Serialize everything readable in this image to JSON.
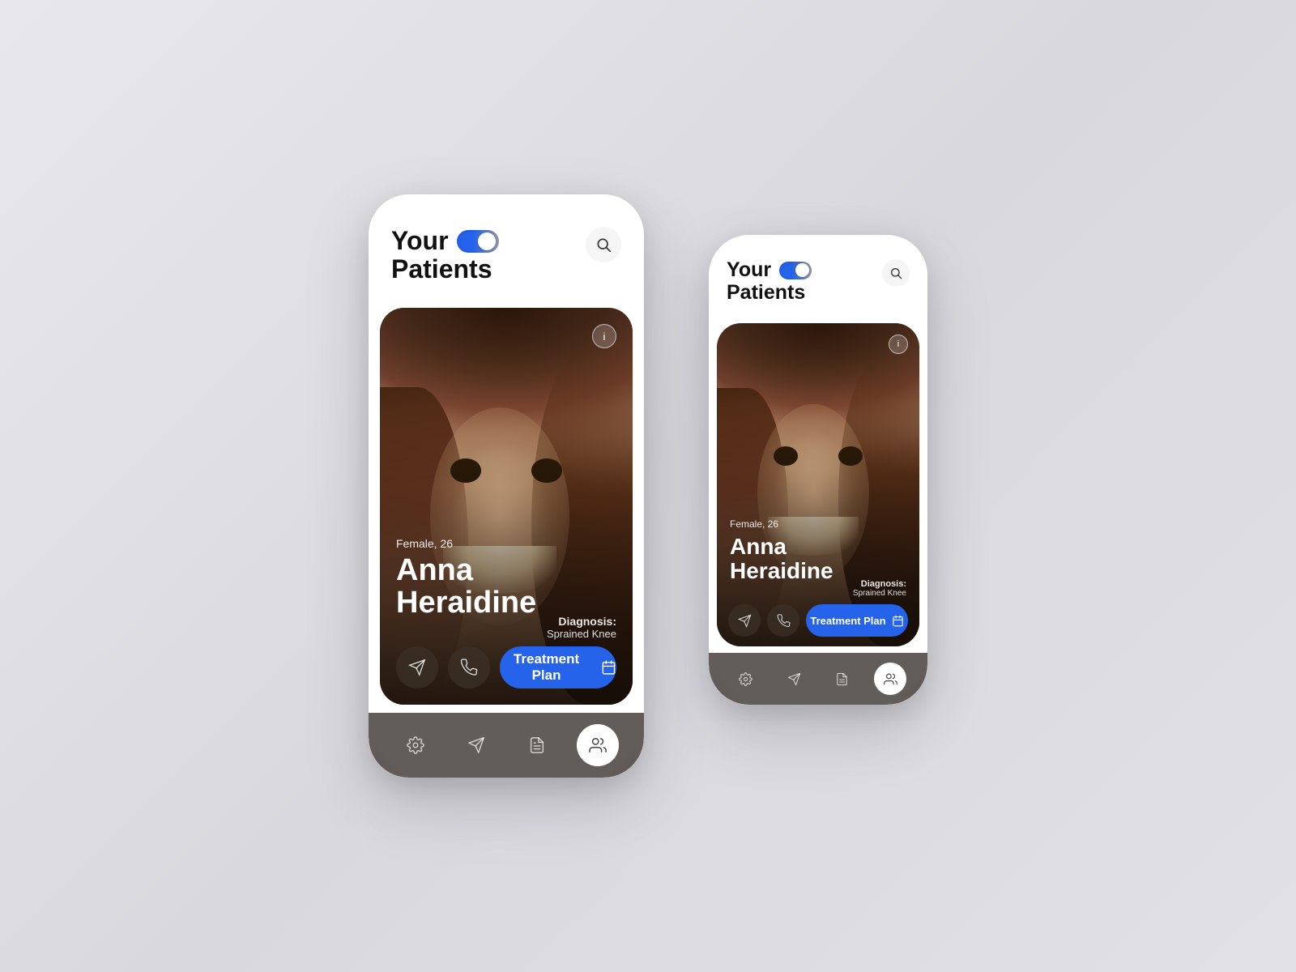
{
  "background": "#dddde4",
  "phones": {
    "large": {
      "header": {
        "title_line1": "Your",
        "title_line2": "Patients",
        "toggle_on": true,
        "search_aria": "Search"
      },
      "patient": {
        "gender_age": "Female, 26",
        "name_line1": "Anna",
        "name_line2": "Heraidine",
        "diagnosis_label": "Diagnosis:",
        "diagnosis_value": "Sprained Knee"
      },
      "actions": {
        "send_aria": "Send message",
        "call_aria": "Call",
        "treatment_plan": "Treatment Plan",
        "calendar_aria": "Calendar"
      },
      "nav": {
        "settings_aria": "Settings",
        "send_aria": "Send",
        "notes_aria": "Notes",
        "patients_aria": "Patients",
        "active_tab": "patients"
      }
    },
    "small": {
      "header": {
        "title_line1": "Your",
        "title_line2": "Patients",
        "toggle_on": true,
        "search_aria": "Search"
      },
      "patient": {
        "gender_age": "Female, 26",
        "name_line1": "Anna",
        "name_line2": "Heraidine",
        "diagnosis_label": "Diagnosis:",
        "diagnosis_value": "Sprained Knee"
      },
      "actions": {
        "send_aria": "Send message",
        "call_aria": "Call",
        "treatment_plan": "Treatment Plan",
        "calendar_aria": "Calendar"
      },
      "nav": {
        "settings_aria": "Settings",
        "send_aria": "Send",
        "notes_aria": "Notes",
        "patients_aria": "Patients",
        "active_tab": "patients"
      }
    }
  },
  "colors": {
    "blue": "#2563eb",
    "dark_card": "rgba(60,50,40,0.7)",
    "nav_bg": "rgba(70,65,60,0.85)",
    "white": "#ffffff"
  }
}
